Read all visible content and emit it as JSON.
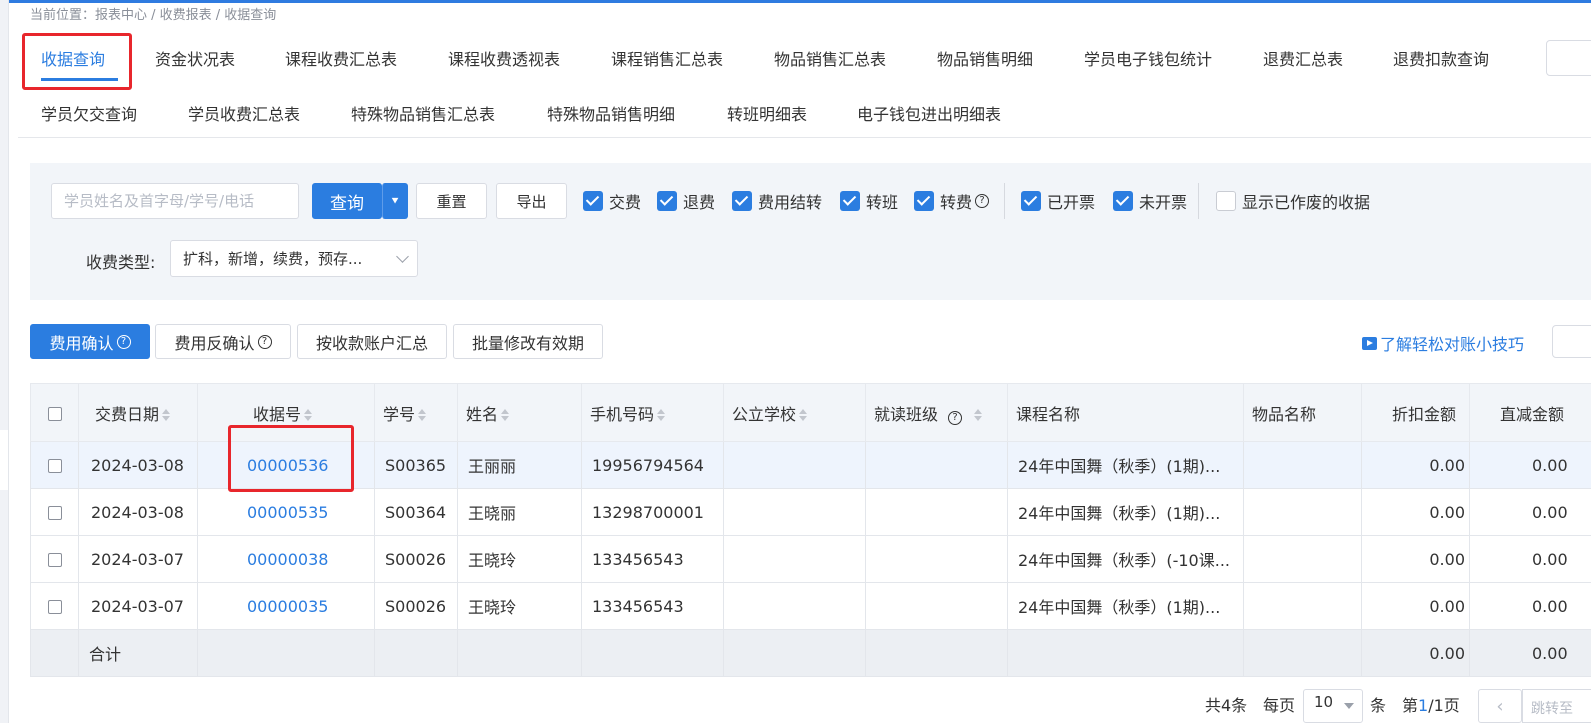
{
  "breadcrumb": "当前位置：报表中心 / 收费报表 / 收据查询",
  "tabs": [
    {
      "label": "收据查询",
      "active": true
    },
    {
      "label": "资金状况表"
    },
    {
      "label": "课程收费汇总表"
    },
    {
      "label": "课程收费透视表"
    },
    {
      "label": "课程销售汇总表"
    },
    {
      "label": "物品销售汇总表"
    },
    {
      "label": "物品销售明细"
    },
    {
      "label": "学员电子钱包统计"
    },
    {
      "label": "退费汇总表"
    },
    {
      "label": "退费扣款查询"
    },
    {
      "label": "学员欠交查询"
    },
    {
      "label": "学员收费汇总表"
    },
    {
      "label": "特殊物品销售汇总表"
    },
    {
      "label": "特殊物品销售明细"
    },
    {
      "label": "转班明细表"
    },
    {
      "label": "电子钱包进出明细表"
    }
  ],
  "filters": {
    "search_placeholder": "学员姓名及首字母/学号/电话",
    "query": "查询",
    "reset": "重置",
    "export": "导出",
    "checkboxes": [
      {
        "label": "交费",
        "checked": true
      },
      {
        "label": "退费",
        "checked": true
      },
      {
        "label": "费用结转",
        "checked": true
      },
      {
        "label": "转班",
        "checked": true
      },
      {
        "label": "转费",
        "checked": true
      },
      {
        "label": "已开票",
        "checked": true
      },
      {
        "label": "未开票",
        "checked": true
      },
      {
        "label": "显示已作废的收据",
        "checked": false
      }
    ],
    "fee_type_label": "收费类型:",
    "fee_type_value": "扩科，新增，续费，预存..."
  },
  "actions": {
    "confirm": "费用确认",
    "unconfirm": "费用反确认",
    "by_account": "按收款账户汇总",
    "batch_edit": "批量修改有效期",
    "tips": "了解轻松对账小技巧"
  },
  "table": {
    "columns": [
      "交费日期",
      "收据号",
      "学号",
      "姓名",
      "手机号码",
      "公立学校",
      "就读班级",
      "课程名称",
      "物品名称",
      "折扣金额",
      "直减金额"
    ],
    "rows": [
      {
        "date": "2024-03-08",
        "receipt": "00000536",
        "sid": "S00365",
        "name": "王丽丽",
        "phone": "19956794564",
        "school": "",
        "class": "",
        "course": "24年中国舞（秋季）(1期)...",
        "item": "",
        "discount": "0.00",
        "reduce": "0.00"
      },
      {
        "date": "2024-03-08",
        "receipt": "00000535",
        "sid": "S00364",
        "name": "王晓丽",
        "phone": "13298700001",
        "school": "",
        "class": "",
        "course": "24年中国舞（秋季）(1期)...",
        "item": "",
        "discount": "0.00",
        "reduce": "0.00"
      },
      {
        "date": "2024-03-07",
        "receipt": "00000038",
        "sid": "S00026",
        "name": "王晓玲",
        "phone": "133456543",
        "school": "",
        "class": "",
        "course": "24年中国舞（秋季）(-10课...",
        "item": "",
        "discount": "0.00",
        "reduce": "0.00"
      },
      {
        "date": "2024-03-07",
        "receipt": "00000035",
        "sid": "S00026",
        "name": "王晓玲",
        "phone": "133456543",
        "school": "",
        "class": "",
        "course": "24年中国舞（秋季）(1期)...",
        "item": "",
        "discount": "0.00",
        "reduce": "0.00"
      }
    ],
    "summary": {
      "label": "合计",
      "discount": "0.00",
      "reduce": "0.00"
    }
  },
  "pager": {
    "total": "共4条",
    "per_page_label": "每页",
    "per_page": "10",
    "unit": "条",
    "page_prefix": "第",
    "current_page": "1",
    "page_suffix": "/1页",
    "jump": "跳转至"
  },
  "colors": {
    "accent": "#2b7de0",
    "highlight_box": "#e8262c"
  }
}
